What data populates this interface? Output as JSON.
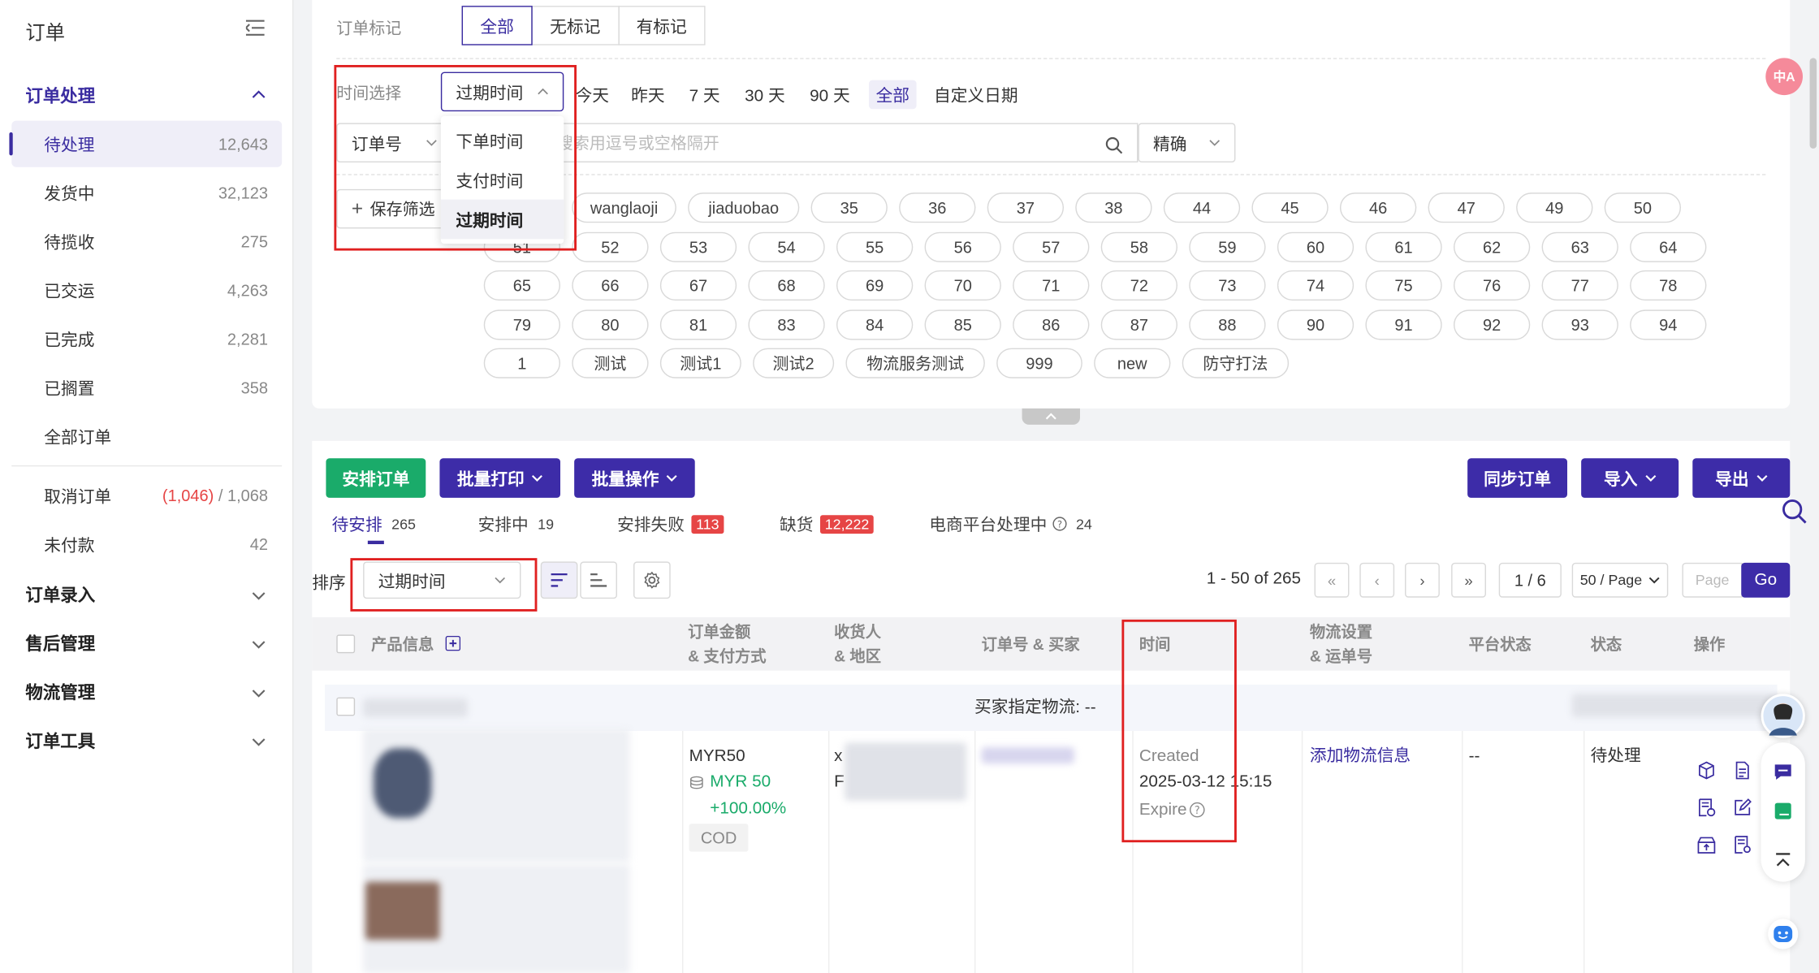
{
  "sidebar": {
    "title": "订单",
    "sections": [
      {
        "label": "订单处理"
      },
      {
        "label": "订单录入"
      },
      {
        "label": "售后管理"
      },
      {
        "label": "物流管理"
      },
      {
        "label": "订单工具"
      }
    ],
    "items": [
      {
        "label": "待处理",
        "count": "12,643"
      },
      {
        "label": "发货中",
        "count": "32,123"
      },
      {
        "label": "待揽收",
        "count": "275"
      },
      {
        "label": "已交运",
        "count": "4,263"
      },
      {
        "label": "已完成",
        "count": "2,281"
      },
      {
        "label": "已搁置",
        "count": "358"
      },
      {
        "label": "全部订单",
        "count": ""
      }
    ],
    "cancel": {
      "label": "取消订单",
      "count_red": "(1,046)",
      "count_rest": " / 1,068"
    },
    "unpaid": {
      "label": "未付款",
      "count": "42"
    }
  },
  "filter": {
    "mark_label": "订单标记",
    "mark_options": [
      "全部",
      "无标记",
      "有标记"
    ],
    "time_label": "时间选择",
    "time_select_value": "过期时间",
    "time_dropdown_options": [
      "下单时间",
      "支付时间",
      "过期时间"
    ],
    "quick_ranges": [
      "今天",
      "昨天",
      "7 天",
      "30 天",
      "90 天",
      "全部",
      "自定义日期"
    ],
    "search_field": "订单号",
    "search_placeholder": "搜索用逗号或空格隔开",
    "match_mode": "精确",
    "save_filter": "保存筛选",
    "tags_row1": [
      "wanglaoji",
      "jiaduobao",
      "35",
      "36",
      "37",
      "38",
      "44",
      "45",
      "46",
      "47",
      "49",
      "50"
    ],
    "tags_row2": [
      "51",
      "52",
      "53",
      "54",
      "55",
      "56",
      "57",
      "58",
      "59",
      "60",
      "61",
      "62",
      "63",
      "64"
    ],
    "tags_row3": [
      "65",
      "66",
      "67",
      "68",
      "69",
      "70",
      "71",
      "72",
      "73",
      "74",
      "75",
      "76",
      "77",
      "78"
    ],
    "tags_row4": [
      "79",
      "80",
      "81",
      "83",
      "84",
      "85",
      "86",
      "87",
      "88",
      "90",
      "91",
      "92",
      "93",
      "94"
    ],
    "tags_row5": [
      "1",
      "测试",
      "测试1",
      "测试2",
      "物流服务测试",
      "999",
      "new",
      "防守打法"
    ]
  },
  "toolbar": {
    "arrange": "安排订单",
    "batch_print": "批量打印",
    "batch_ops": "批量操作",
    "sync": "同步订单",
    "import": "导入",
    "export": "导出"
  },
  "subtabs": [
    {
      "label": "待安排",
      "count": "265"
    },
    {
      "label": "安排中",
      "count": "19"
    },
    {
      "label": "安排失败",
      "count": "113"
    },
    {
      "label": "缺货",
      "count": "12,222"
    },
    {
      "label": "电商平台处理中",
      "count": "24"
    }
  ],
  "sort": {
    "label": "排序",
    "value": "过期时间"
  },
  "pager": {
    "range": "1 - 50 of 265",
    "page": "1 / 6",
    "page_size": "50 / Page",
    "page_placeholder": "Page",
    "go": "Go"
  },
  "table": {
    "headers": {
      "product": "产品信息",
      "amount": [
        "订单金额",
        "& 支付方式"
      ],
      "receiver": [
        "收货人",
        "& 地区"
      ],
      "order_buyer": "订单号 & 买家",
      "time": "时间",
      "logistics": [
        "物流设置",
        "& 运单号"
      ],
      "platform_status": "平台状态",
      "status": "状态",
      "actions": "操作"
    },
    "group_label": "买家指定物流: --",
    "row": {
      "amount": "MYR50",
      "amount_paid": "MYR 50",
      "amount_pct": "+100.00%",
      "pay_method": "COD",
      "receiver_initials": [
        "x",
        "F"
      ],
      "time_created_label": "Created",
      "time_created": "2025-03-12 15:15",
      "time_expire_label": "Expire",
      "logistics": "添加物流信息",
      "platform_status": "--",
      "status": "待处理"
    }
  },
  "colors": {
    "brand": "#3a2ca0",
    "green": "#1aab6a",
    "red": "#e64545",
    "highlight": "#e02020"
  }
}
